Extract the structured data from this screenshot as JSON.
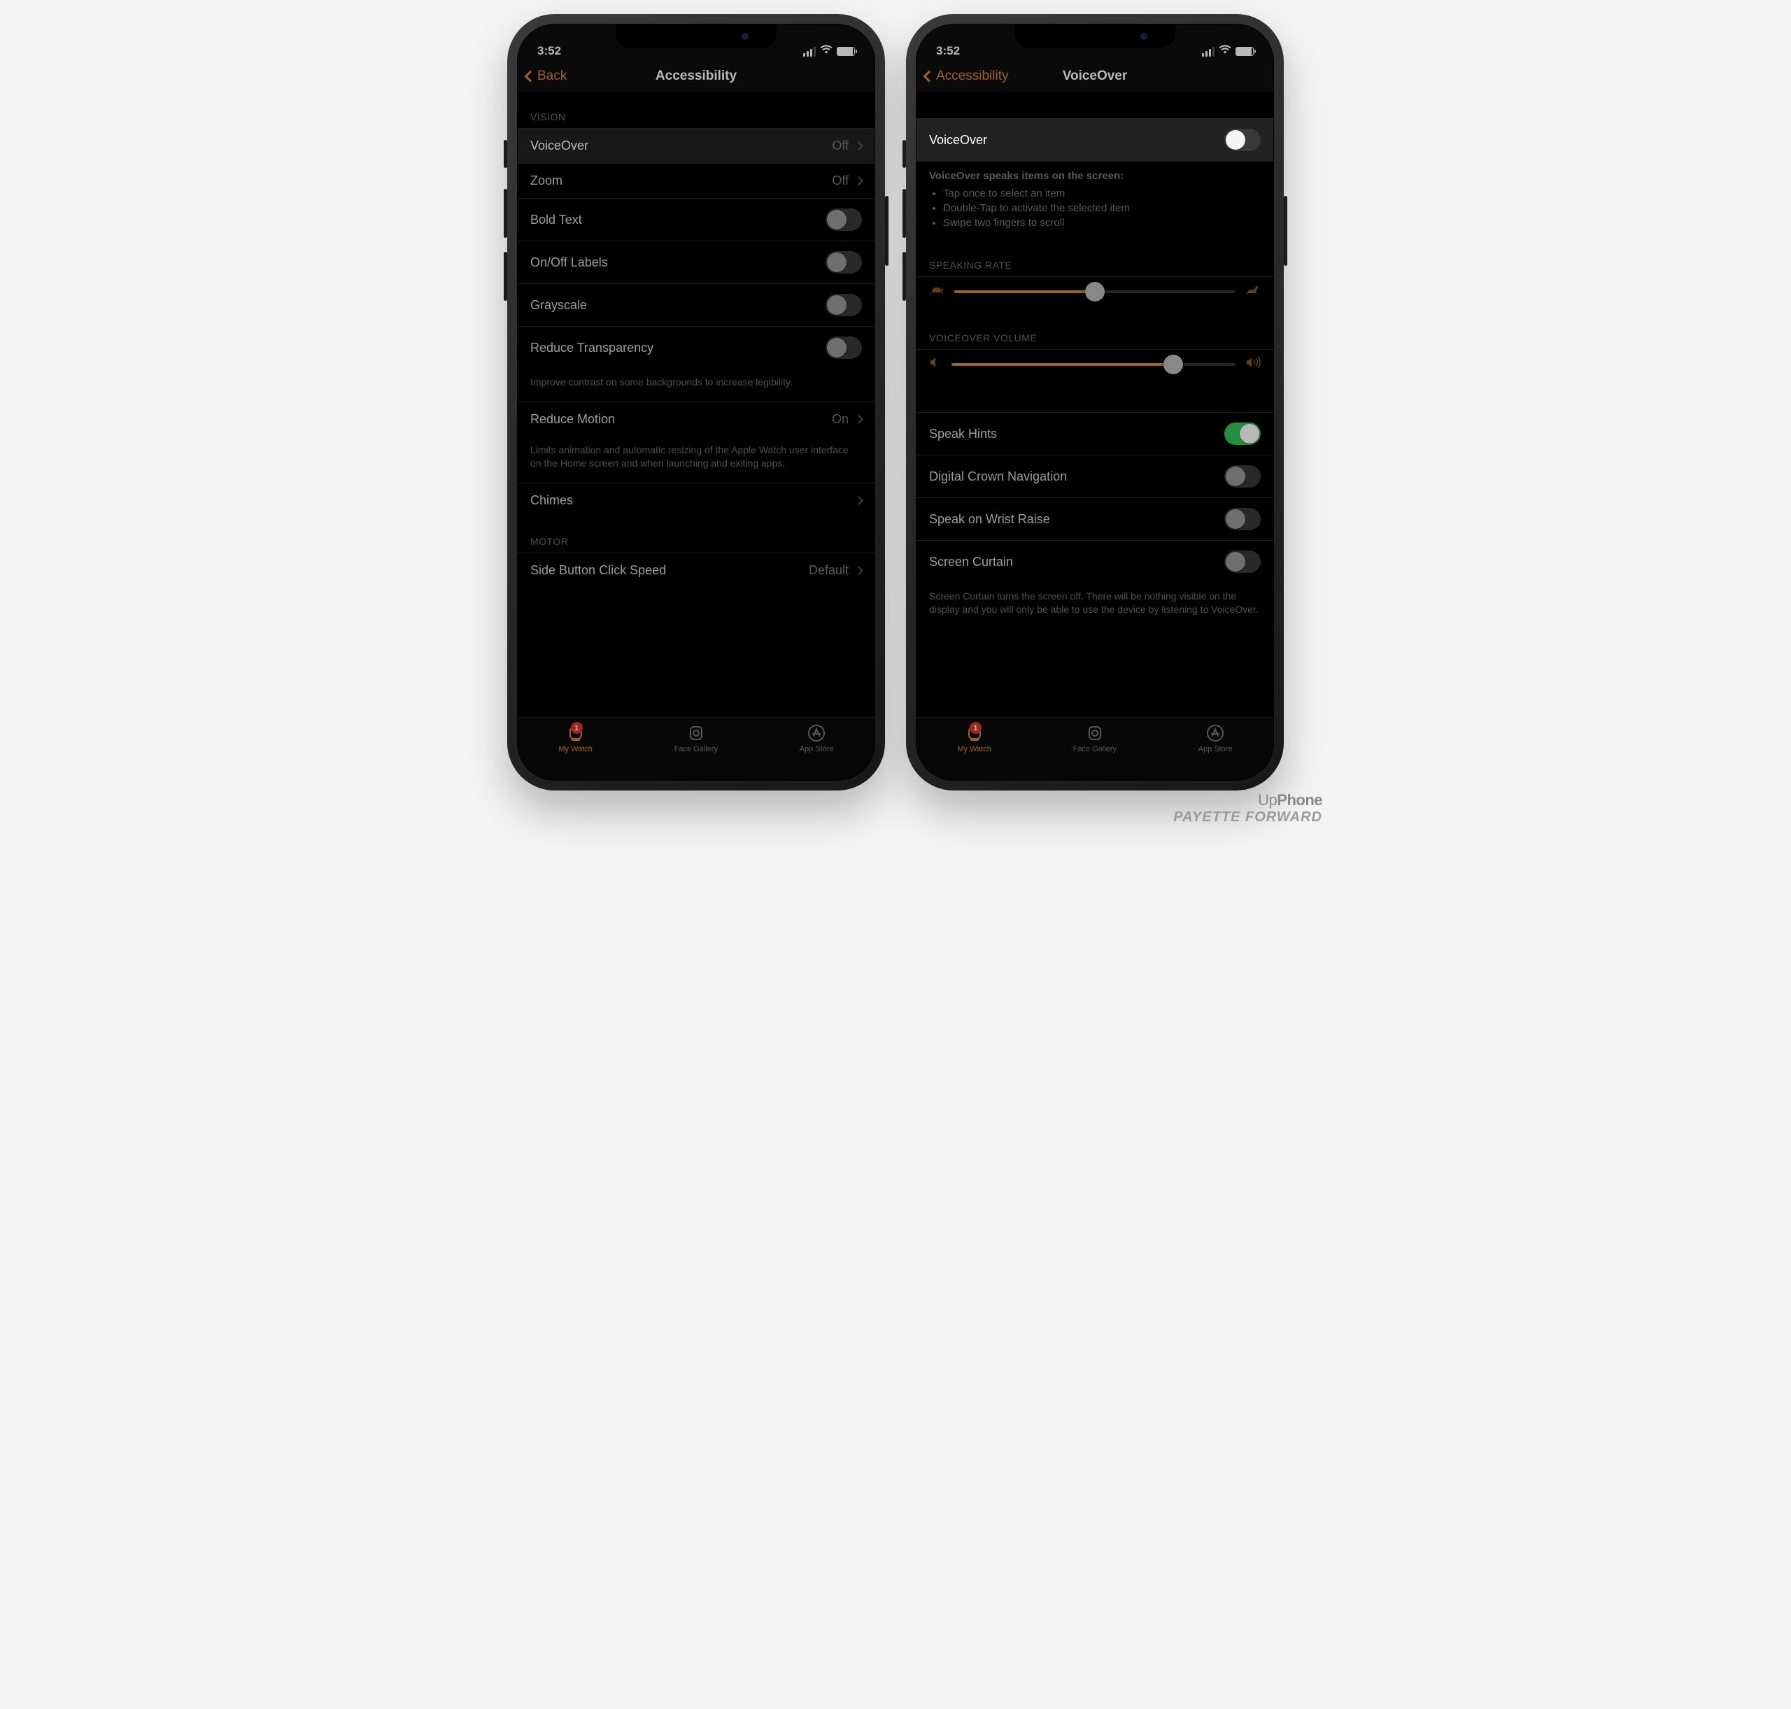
{
  "status": {
    "time": "3:52"
  },
  "phone1": {
    "nav": {
      "back": "Back",
      "title": "Accessibility"
    },
    "vision_header": "VISION",
    "rows": {
      "voiceover": {
        "label": "VoiceOver",
        "value": "Off"
      },
      "zoom": {
        "label": "Zoom",
        "value": "Off"
      },
      "bold": {
        "label": "Bold Text"
      },
      "onoff": {
        "label": "On/Off Labels"
      },
      "gray": {
        "label": "Grayscale"
      },
      "transp": {
        "label": "Reduce Transparency"
      },
      "transp_note": "Improve contrast on some backgrounds to increase legibility.",
      "motion": {
        "label": "Reduce Motion",
        "value": "On"
      },
      "motion_note": "Limits animation and automatic resizing of the Apple Watch user interface on the Home screen and when launching and exiting apps.",
      "chimes": {
        "label": "Chimes"
      }
    },
    "motor_header": "MOTOR",
    "motor": {
      "side": {
        "label": "Side Button Click Speed",
        "value": "Default"
      }
    }
  },
  "phone2": {
    "nav": {
      "back": "Accessibility",
      "title": "VoiceOver"
    },
    "top": {
      "toggle_label": "VoiceOver",
      "desc_lead": "VoiceOver speaks items on the screen:",
      "desc_items": [
        "Tap once to select an item",
        "Double-Tap to activate the selected item",
        "Swipe two fingers to scroll"
      ]
    },
    "speaking_rate": {
      "header": "SPEAKING RATE",
      "value_pct": 50
    },
    "volume": {
      "header": "VOICEOVER VOLUME",
      "value_pct": 78
    },
    "rows": {
      "hints": {
        "label": "Speak Hints",
        "on": true
      },
      "crown": {
        "label": "Digital Crown Navigation",
        "on": false
      },
      "wrist": {
        "label": "Speak on Wrist Raise",
        "on": false
      },
      "curtain": {
        "label": "Screen Curtain",
        "on": false
      },
      "curtain_note": "Screen Curtain turns the screen off. There will be nothing visible on the display and you will only be able to use the device by listening to VoiceOver."
    }
  },
  "tabs": {
    "watch": {
      "label": "My Watch",
      "badge": "1"
    },
    "gallery": {
      "label": "Face Gallery"
    },
    "store": {
      "label": "App Store"
    }
  },
  "watermark": {
    "line1a": "Up",
    "line1b": "Phone",
    "line2": "PAYETTE FORWARD"
  }
}
